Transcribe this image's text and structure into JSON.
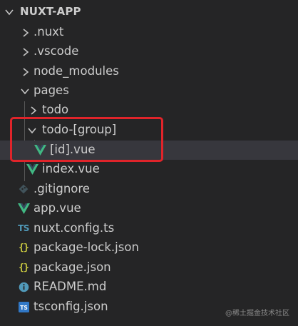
{
  "explorer": {
    "root_label": "NUXT-APP",
    "items": [
      {
        "label": ".nuxt",
        "kind": "folder",
        "state": "collapsed",
        "icon": "chevron-right-icon"
      },
      {
        "label": ".vscode",
        "kind": "folder",
        "state": "collapsed",
        "icon": "chevron-right-icon"
      },
      {
        "label": "node_modules",
        "kind": "folder",
        "state": "collapsed",
        "icon": "chevron-right-icon"
      },
      {
        "label": "pages",
        "kind": "folder",
        "state": "expanded",
        "icon": "chevron-down-icon"
      },
      {
        "label": "todo",
        "kind": "folder",
        "state": "collapsed",
        "icon": "chevron-right-icon"
      },
      {
        "label": "todo-[group]",
        "kind": "folder",
        "state": "expanded",
        "icon": "chevron-down-icon"
      },
      {
        "label": "[id].vue",
        "kind": "file",
        "icon": "vue-icon",
        "selected": true
      },
      {
        "label": "index.vue",
        "kind": "file",
        "icon": "vue-icon"
      },
      {
        "label": ".gitignore",
        "kind": "file",
        "icon": "git-icon"
      },
      {
        "label": "app.vue",
        "kind": "file",
        "icon": "vue-icon"
      },
      {
        "label": "nuxt.config.ts",
        "kind": "file",
        "icon": "typescript-icon",
        "icon_text": "TS"
      },
      {
        "label": "package-lock.json",
        "kind": "file",
        "icon": "json-icon",
        "icon_text": "{}"
      },
      {
        "label": "package.json",
        "kind": "file",
        "icon": "json-icon",
        "icon_text": "{}"
      },
      {
        "label": "README.md",
        "kind": "file",
        "icon": "info-icon"
      },
      {
        "label": "tsconfig.json",
        "kind": "file",
        "icon": "tsconfig-icon",
        "icon_text": "TS"
      }
    ]
  },
  "watermark": "@稀土掘金技术社区",
  "colors": {
    "background": "#252526",
    "text": "#cccccc",
    "vue_green": "#41b883",
    "typescript_blue": "#519aba",
    "json_yellow": "#cbcb41",
    "highlight_red": "#e0242a",
    "selection": "#37373d"
  }
}
